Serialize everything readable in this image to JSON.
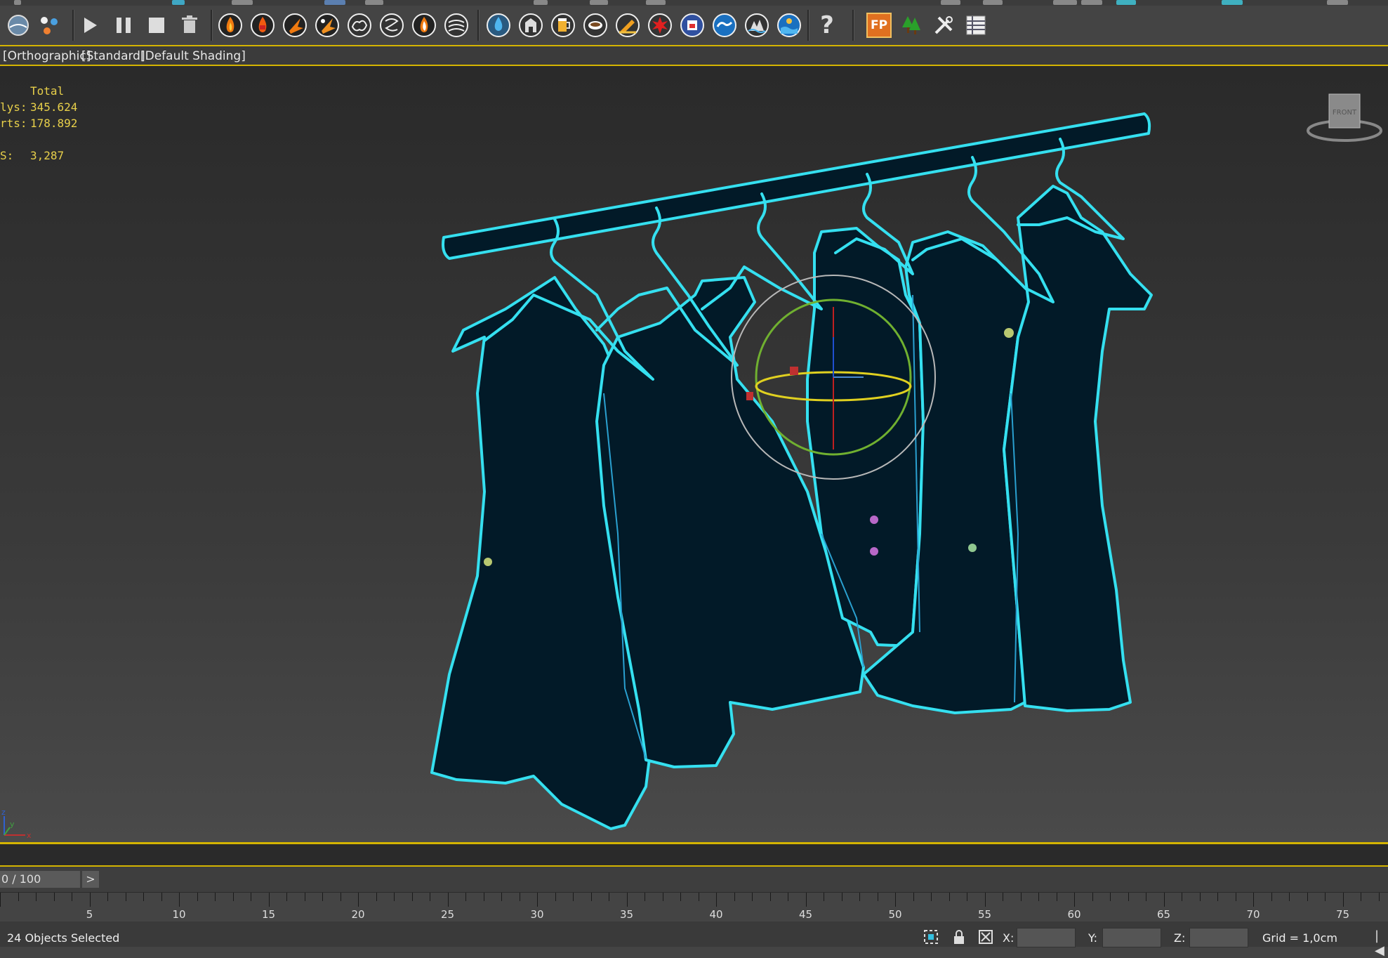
{
  "toolbar": {
    "icons": [
      "globe-icon",
      "particles-icon",
      "play-icon",
      "pause-icon",
      "stop-icon",
      "trash-icon",
      "fire-icon",
      "fire-icon",
      "fire-icon",
      "fire-icon",
      "smoke-icon",
      "smoke-icon",
      "fire-icon",
      "smoke-icon",
      "water-icon",
      "building-icon",
      "beer-icon",
      "coffee-icon",
      "liquid-icon",
      "splash-icon",
      "container-icon",
      "wave-icon",
      "ocean-icon",
      "ocean-icon",
      "help-icon",
      "fp-icon",
      "tree-icon",
      "tools-icon",
      "table-icon"
    ],
    "fp_label": "FP",
    "help_label": "?"
  },
  "viewport": {
    "labels": [
      "[Orthographic]",
      "[Standard]",
      "[Default Shading]"
    ],
    "stats": {
      "header": "Total",
      "polys_label": "lys:",
      "polys_value": "345.624",
      "verts_label": "rts:",
      "verts_value": "178.892",
      "fps_label": "S:",
      "fps_value": "3,287"
    },
    "viewcube_label": "FRONT",
    "axis_labels": {
      "x": "x",
      "y": "y",
      "z": "z"
    }
  },
  "timeline": {
    "slider": "0 / 100",
    "next": ">",
    "ticks": [
      "5",
      "10",
      "15",
      "20",
      "25",
      "30",
      "35",
      "40",
      "45",
      "50",
      "55",
      "60",
      "65",
      "70",
      "75"
    ]
  },
  "status": {
    "selection": "24 Objects Selected",
    "x_label": "X:",
    "y_label": "Y:",
    "z_label": "Z:",
    "grid": "Grid = 1,0cm"
  },
  "colors": {
    "selection_outline": "#35e0f0",
    "viewport_border": "#d4b400",
    "stats_text": "#e8d04a",
    "garment_fill": "#021a28"
  }
}
